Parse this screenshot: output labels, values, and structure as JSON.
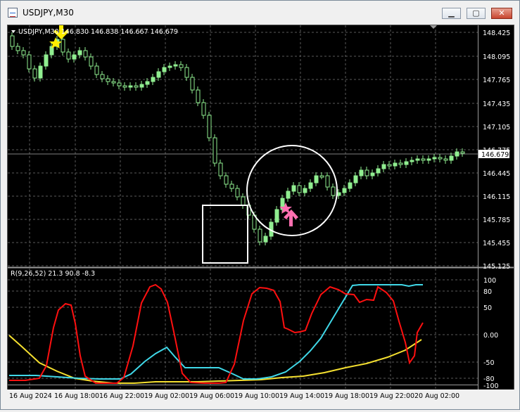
{
  "window": {
    "title": "USDJPY,M30"
  },
  "main_info": "USDJPY,M30  146.830 146.838 146.667 146.679",
  "price_axis": {
    "labels": [
      "148.425",
      "148.095",
      "147.765",
      "147.435",
      "147.105",
      "146.775",
      "146.445",
      "146.115",
      "145.785",
      "145.455",
      "145.125"
    ],
    "current_price": "146.679"
  },
  "indicator": {
    "label": "R(9,26,52) 21.3 90.8 -8.3",
    "axis_labels": [
      "100",
      "80",
      "50",
      "0.00",
      "-50",
      "-80",
      "-100"
    ]
  },
  "time_axis": {
    "labels": [
      "16 Aug 2024",
      "16 Aug 18:00",
      "16 Aug 22:00",
      "19 Aug 02:00",
      "19 Aug 06:00",
      "19 Aug 10:00",
      "19 Aug 14:00",
      "19 Aug 18:00",
      "19 Aug 22:00",
      "20 Aug 02:00"
    ]
  },
  "colors": {
    "candle": "#90ee90",
    "red_line": "#ff1010",
    "cyan_line": "#40d8e8",
    "yellow_line": "#f5e030",
    "marker_yellow": "#ffee00",
    "marker_pink": "#ff6fb0",
    "annotation": "#ffffff"
  }
}
